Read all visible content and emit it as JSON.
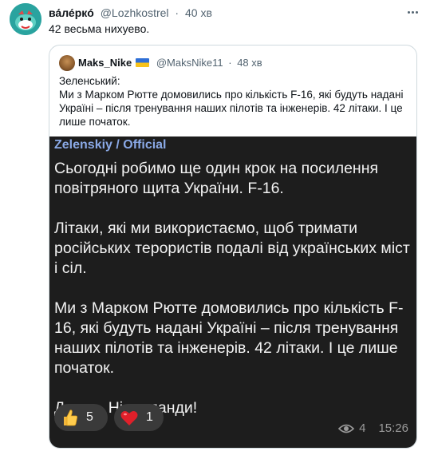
{
  "tweet": {
    "author_name": "ва́ле́ркó",
    "author_handle": "@Lozhkostrel",
    "time": "40 хв",
    "text": "42 весьма нихуево."
  },
  "quote": {
    "author_name": "Maks_Nike",
    "author_handle": "@MaksNike11",
    "time": "48 хв",
    "text_line1": "Зеленський:",
    "text_line2": "Ми з Марком Рютте домовились про кількість F-16, які будуть надані Україні – після тренування наших пілотів та інженерів. 42 літаки. І це лише початок."
  },
  "media": {
    "channel": "Zelenskiy / Official",
    "paragraphs": [
      "Сьогодні робимо ще один крок на посилення повітряного щита України. F-16.",
      "Літаки, які ми використаємо, щоб тримати російських терористів подалі від українських міст і сіл.",
      "Ми з Марком Рютте домовились про кількість F-16, які будуть надані Україні – після тренування наших пілотів та інженерів. 42 літаки. І це лише початок.",
      "Дякую, Нідерланди!"
    ],
    "reactions": [
      {
        "emoji": "thumbs-up",
        "count": "5"
      },
      {
        "emoji": "heart",
        "count": "1"
      }
    ],
    "views": "4",
    "post_time": "15:26"
  },
  "colors": {
    "accent_channel": "#8aa9e6",
    "media_bg": "#1d1d1d",
    "border": "#cfd9de",
    "secondary_text": "#536471"
  }
}
